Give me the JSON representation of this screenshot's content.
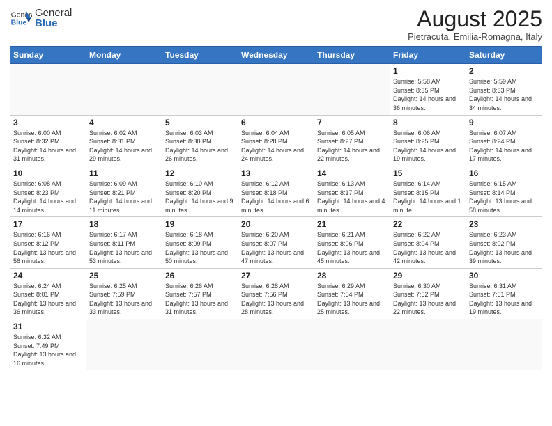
{
  "header": {
    "logo_general": "General",
    "logo_blue": "Blue",
    "month_title": "August 2025",
    "subtitle": "Pietracuta, Emilia-Romagna, Italy"
  },
  "days_of_week": [
    "Sunday",
    "Monday",
    "Tuesday",
    "Wednesday",
    "Thursday",
    "Friday",
    "Saturday"
  ],
  "weeks": [
    [
      {
        "day": "",
        "info": ""
      },
      {
        "day": "",
        "info": ""
      },
      {
        "day": "",
        "info": ""
      },
      {
        "day": "",
        "info": ""
      },
      {
        "day": "",
        "info": ""
      },
      {
        "day": "1",
        "info": "Sunrise: 5:58 AM\nSunset: 8:35 PM\nDaylight: 14 hours and 36 minutes."
      },
      {
        "day": "2",
        "info": "Sunrise: 5:59 AM\nSunset: 8:33 PM\nDaylight: 14 hours and 34 minutes."
      }
    ],
    [
      {
        "day": "3",
        "info": "Sunrise: 6:00 AM\nSunset: 8:32 PM\nDaylight: 14 hours and 31 minutes."
      },
      {
        "day": "4",
        "info": "Sunrise: 6:02 AM\nSunset: 8:31 PM\nDaylight: 14 hours and 29 minutes."
      },
      {
        "day": "5",
        "info": "Sunrise: 6:03 AM\nSunset: 8:30 PM\nDaylight: 14 hours and 26 minutes."
      },
      {
        "day": "6",
        "info": "Sunrise: 6:04 AM\nSunset: 8:28 PM\nDaylight: 14 hours and 24 minutes."
      },
      {
        "day": "7",
        "info": "Sunrise: 6:05 AM\nSunset: 8:27 PM\nDaylight: 14 hours and 22 minutes."
      },
      {
        "day": "8",
        "info": "Sunrise: 6:06 AM\nSunset: 8:25 PM\nDaylight: 14 hours and 19 minutes."
      },
      {
        "day": "9",
        "info": "Sunrise: 6:07 AM\nSunset: 8:24 PM\nDaylight: 14 hours and 17 minutes."
      }
    ],
    [
      {
        "day": "10",
        "info": "Sunrise: 6:08 AM\nSunset: 8:23 PM\nDaylight: 14 hours and 14 minutes."
      },
      {
        "day": "11",
        "info": "Sunrise: 6:09 AM\nSunset: 8:21 PM\nDaylight: 14 hours and 11 minutes."
      },
      {
        "day": "12",
        "info": "Sunrise: 6:10 AM\nSunset: 8:20 PM\nDaylight: 14 hours and 9 minutes."
      },
      {
        "day": "13",
        "info": "Sunrise: 6:12 AM\nSunset: 8:18 PM\nDaylight: 14 hours and 6 minutes."
      },
      {
        "day": "14",
        "info": "Sunrise: 6:13 AM\nSunset: 8:17 PM\nDaylight: 14 hours and 4 minutes."
      },
      {
        "day": "15",
        "info": "Sunrise: 6:14 AM\nSunset: 8:15 PM\nDaylight: 14 hours and 1 minute."
      },
      {
        "day": "16",
        "info": "Sunrise: 6:15 AM\nSunset: 8:14 PM\nDaylight: 13 hours and 58 minutes."
      }
    ],
    [
      {
        "day": "17",
        "info": "Sunrise: 6:16 AM\nSunset: 8:12 PM\nDaylight: 13 hours and 56 minutes."
      },
      {
        "day": "18",
        "info": "Sunrise: 6:17 AM\nSunset: 8:11 PM\nDaylight: 13 hours and 53 minutes."
      },
      {
        "day": "19",
        "info": "Sunrise: 6:18 AM\nSunset: 8:09 PM\nDaylight: 13 hours and 50 minutes."
      },
      {
        "day": "20",
        "info": "Sunrise: 6:20 AM\nSunset: 8:07 PM\nDaylight: 13 hours and 47 minutes."
      },
      {
        "day": "21",
        "info": "Sunrise: 6:21 AM\nSunset: 8:06 PM\nDaylight: 13 hours and 45 minutes."
      },
      {
        "day": "22",
        "info": "Sunrise: 6:22 AM\nSunset: 8:04 PM\nDaylight: 13 hours and 42 minutes."
      },
      {
        "day": "23",
        "info": "Sunrise: 6:23 AM\nSunset: 8:02 PM\nDaylight: 13 hours and 39 minutes."
      }
    ],
    [
      {
        "day": "24",
        "info": "Sunrise: 6:24 AM\nSunset: 8:01 PM\nDaylight: 13 hours and 36 minutes."
      },
      {
        "day": "25",
        "info": "Sunrise: 6:25 AM\nSunset: 7:59 PM\nDaylight: 13 hours and 33 minutes."
      },
      {
        "day": "26",
        "info": "Sunrise: 6:26 AM\nSunset: 7:57 PM\nDaylight: 13 hours and 31 minutes."
      },
      {
        "day": "27",
        "info": "Sunrise: 6:28 AM\nSunset: 7:56 PM\nDaylight: 13 hours and 28 minutes."
      },
      {
        "day": "28",
        "info": "Sunrise: 6:29 AM\nSunset: 7:54 PM\nDaylight: 13 hours and 25 minutes."
      },
      {
        "day": "29",
        "info": "Sunrise: 6:30 AM\nSunset: 7:52 PM\nDaylight: 13 hours and 22 minutes."
      },
      {
        "day": "30",
        "info": "Sunrise: 6:31 AM\nSunset: 7:51 PM\nDaylight: 13 hours and 19 minutes."
      }
    ],
    [
      {
        "day": "31",
        "info": "Sunrise: 6:32 AM\nSunset: 7:49 PM\nDaylight: 13 hours and 16 minutes."
      },
      {
        "day": "",
        "info": ""
      },
      {
        "day": "",
        "info": ""
      },
      {
        "day": "",
        "info": ""
      },
      {
        "day": "",
        "info": ""
      },
      {
        "day": "",
        "info": ""
      },
      {
        "day": "",
        "info": ""
      }
    ]
  ]
}
